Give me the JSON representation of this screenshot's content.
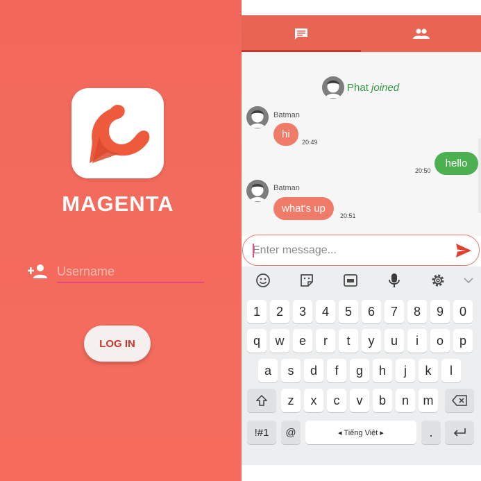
{
  "login": {
    "app_name": "MAGENTA",
    "username_placeholder": "Username",
    "login_button": "LOG IN",
    "colors": {
      "background": "#f36b5d",
      "logo_orange": "#ee5a3c",
      "underline": "#e8477a"
    }
  },
  "chat": {
    "tabs": [
      {
        "icon": "chat-icon",
        "active": true
      },
      {
        "icon": "people-icon",
        "active": false
      }
    ],
    "joined": {
      "user": "Phat",
      "action": "joined"
    },
    "messages": [
      {
        "sender": "Batman",
        "text": "hi",
        "time": "20:49",
        "direction": "incoming"
      },
      {
        "sender": "",
        "text": "hello",
        "time": "20:50",
        "direction": "outgoing"
      },
      {
        "sender": "Batman",
        "text": "what's up",
        "time": "20:51",
        "direction": "incoming"
      }
    ],
    "composer": {
      "placeholder": "Enter message...",
      "send_icon": "send-icon"
    },
    "colors": {
      "tabbar": "#e96553",
      "incoming_bubble": "#f17b69",
      "outgoing_bubble": "#4caf50",
      "joined_text": "#2f9a40"
    }
  },
  "keyboard": {
    "toolbar": [
      "emoji-icon",
      "sticker-icon",
      "gif-icon",
      "microphone-icon",
      "settings-icon",
      "chevron-down-icon"
    ],
    "rows": [
      [
        "1",
        "2",
        "3",
        "4",
        "5",
        "6",
        "7",
        "8",
        "9",
        "0"
      ],
      [
        "q",
        "w",
        "e",
        "r",
        "t",
        "y",
        "u",
        "i",
        "o",
        "p"
      ],
      [
        "a",
        "s",
        "d",
        "f",
        "g",
        "h",
        "j",
        "k",
        "l"
      ],
      [
        "z",
        "x",
        "c",
        "v",
        "b",
        "n",
        "m"
      ]
    ],
    "symbols_key": "!#1",
    "at_key": "@",
    "space_label": "◂ Tiếng Việt ▸",
    "period_key": "."
  }
}
